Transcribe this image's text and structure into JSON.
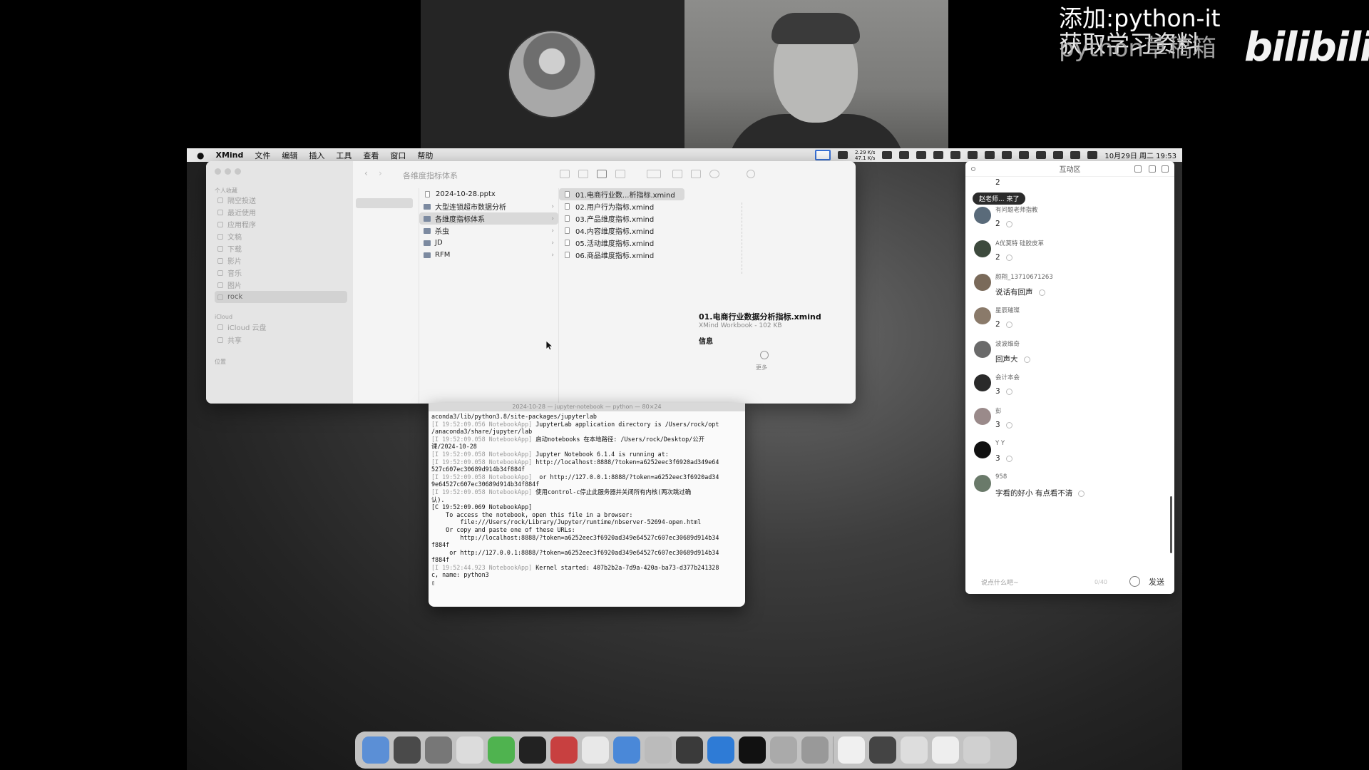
{
  "overlay": {
    "promo_line1": "添加:python-it",
    "promo_line2": "获取学习资料",
    "promo_ghost": "python草稿箱",
    "brand": "bilibili"
  },
  "menubar": {
    "app_name": "XMind",
    "menus": [
      "文件",
      "编辑",
      "插入",
      "工具",
      "查看",
      "窗口",
      "帮助"
    ],
    "datetime": "10月29日 周二 19:53",
    "net_speed_up": "2.29 K/s",
    "net_speed_down": "47.1 K/s"
  },
  "finder": {
    "title": "各维度指标体系",
    "sidebar": {
      "section1": "个人收藏",
      "items": [
        "隔空投送",
        "最近使用",
        "应用程序",
        "文稿",
        "下载",
        "影片",
        "音乐",
        "图片",
        "rock"
      ],
      "section2": "iCloud",
      "items2": [
        "iCloud 云盘",
        "共享"
      ],
      "section3": "位置"
    },
    "column2": [
      {
        "name": "2024-10-28.pptx",
        "kind": "doc"
      },
      {
        "name": "大型连锁超市数据分析",
        "kind": "folder"
      },
      {
        "name": "各维度指标体系",
        "kind": "folder",
        "selected": true
      },
      {
        "name": "杀虫",
        "kind": "folder"
      },
      {
        "name": "JD",
        "kind": "folder"
      },
      {
        "name": "RFM",
        "kind": "folder"
      }
    ],
    "column3": [
      {
        "name": "01.电商行业数...析指标.xmind",
        "selected": true
      },
      {
        "name": "02.用户行为指标.xmind"
      },
      {
        "name": "03.产品维度指标.xmind"
      },
      {
        "name": "04.内容维度指标.xmind"
      },
      {
        "name": "05.活动维度指标.xmind"
      },
      {
        "name": "06.商品维度指标.xmind"
      }
    ],
    "preview": {
      "filename": "01.电商行业数据分析指标.xmind",
      "kind": "XMind Workbook - 102 KB",
      "info_label": "信息",
      "more_label": "更多"
    }
  },
  "terminal": {
    "title": "2024-10-28 — jupyter-notebook — python — 80×24",
    "lines": [
      {
        "t": "aconda3/lib/python3.8/site-packages/jupyterlab"
      },
      {
        "p": "[I 19:52:09.056 NotebookApp]",
        "t": " JupyterLab application directory is /Users/rock/opt"
      },
      {
        "t": "/anaconda3/share/jupyter/lab"
      },
      {
        "p": "[I 19:52:09.058 NotebookApp]",
        "t": " 启动notebooks 在本地路径: /Users/rock/Desktop/公开"
      },
      {
        "t": "课/2024-10-28"
      },
      {
        "p": "[I 19:52:09.058 NotebookApp]",
        "t": " Jupyter Notebook 6.1.4 is running at:"
      },
      {
        "p": "[I 19:52:09.058 NotebookApp]",
        "t": " http://localhost:8888/?token=a6252eec3f6920ad349e64"
      },
      {
        "t": "527c607ec30689d914b34f884f"
      },
      {
        "p": "[I 19:52:09.058 NotebookApp]",
        "t": "  or http://127.0.0.1:8888/?token=a6252eec3f6920ad34"
      },
      {
        "t": "9e64527c607ec30689d914b34f884f"
      },
      {
        "p": "[I 19:52:09.058 NotebookApp]",
        "t": " 使用control-c停止此服务器并关闭所有内核(两次跳过确"
      },
      {
        "t": "认)."
      },
      {
        "t": "[C 19:52:09.069 NotebookApp]"
      },
      {
        "t": ""
      },
      {
        "t": "    To access the notebook, open this file in a browser:"
      },
      {
        "t": "        file:///Users/rock/Library/Jupyter/runtime/nbserver-52694-open.html"
      },
      {
        "t": "    Or copy and paste one of these URLs:"
      },
      {
        "t": "        http://localhost:8888/?token=a6252eec3f6920ad349e64527c607ec30689d914b34"
      },
      {
        "t": "f884f"
      },
      {
        "t": "     or http://127.0.0.1:8888/?token=a6252eec3f6920ad349e64527c607ec30689d914b34"
      },
      {
        "t": "f884f"
      },
      {
        "p": "[I 19:52:44.923 NotebookApp]",
        "t": " Kernel started: 407b2b2a-7d9a-420a-ba73-d377b241328"
      },
      {
        "t": "c, name: python3"
      },
      {
        "t": "▯"
      }
    ]
  },
  "chat": {
    "title": "互动区",
    "top_count": "2",
    "toast": "赵老师... 来了",
    "messages": [
      {
        "name": "有问题老师指教",
        "text": "2"
      },
      {
        "name": "A优莫特 硅胶皮革",
        "text": "2"
      },
      {
        "name": "颜翔_13710671263",
        "text": "说话有回声"
      },
      {
        "name": "星辰璀璨",
        "text": "2"
      },
      {
        "name": "波波维奇",
        "text": "回声大"
      },
      {
        "name": "会计本会",
        "text": "3"
      },
      {
        "name": "彭",
        "text": "3"
      },
      {
        "name": "Y Y",
        "text": "3"
      },
      {
        "name": "958",
        "text": "字看的好小 有点看不清"
      }
    ],
    "input_placeholder": "说点什么吧~",
    "input_count": "0/40",
    "send_label": "发送"
  },
  "dock": {
    "apps": [
      "finder-icon",
      "launchpad-icon",
      "chrome-icon",
      "qq-browser-icon",
      "wechat-icon",
      "qq-icon",
      "wps-icon",
      "notes-icon",
      "mail-icon",
      "preview-icon",
      "python-icon",
      "vscode-icon",
      "terminal-icon",
      "archive-icon",
      "xmind-icon"
    ],
    "docs": [
      "document-icon",
      "screen-recording-icon",
      "folder-stack-icon",
      "downloads-icon",
      "trash-icon"
    ]
  },
  "colors": {
    "menubar_bg": "#e9e9e9",
    "selection_blue": "#3a73d8",
    "dock_bg": "#e6e6e6"
  }
}
